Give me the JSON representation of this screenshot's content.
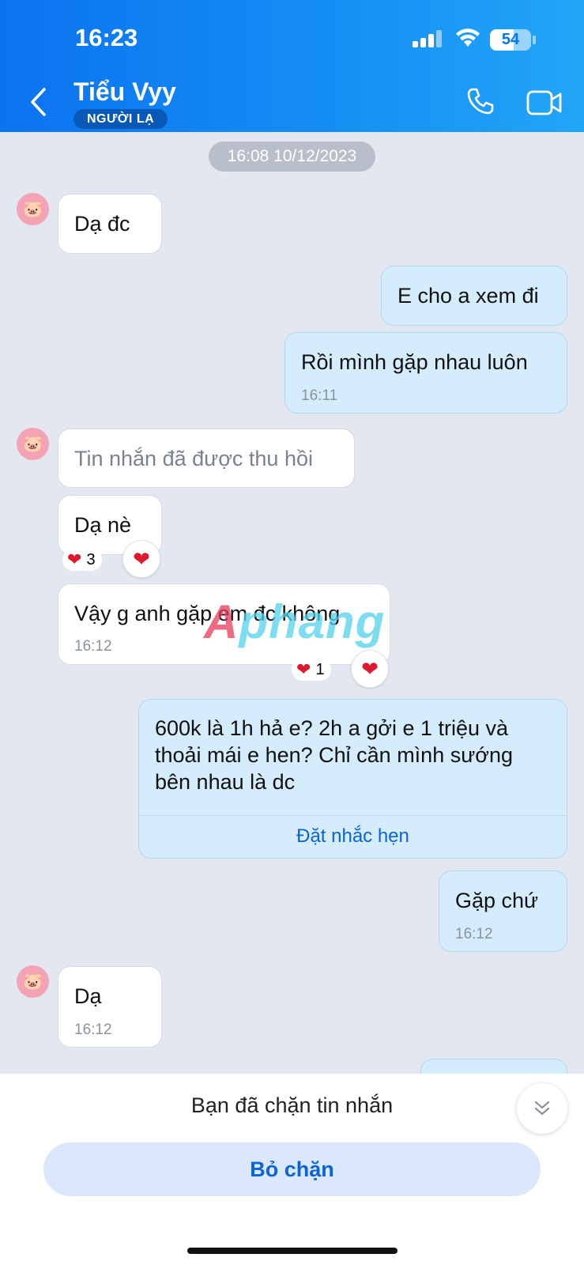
{
  "status_bar": {
    "time": "16:23",
    "battery": "54"
  },
  "header": {
    "contact_name": "Tiểu Vyy",
    "badge": "NGƯỜI LẠ"
  },
  "chat": {
    "date_separator": "16:08 10/12/2023",
    "messages": [
      {
        "text": "Dạ đc"
      },
      {
        "text": "E cho a xem đi"
      },
      {
        "text": "Rồi mình gặp nhau luôn",
        "time": "16:11"
      },
      {
        "text": "Tin nhắn đã được thu hồi"
      },
      {
        "text": "Dạ nè",
        "reaction_count": "3"
      },
      {
        "text": "Vậy g anh gặp em đc không",
        "time": "16:12",
        "reaction_count": "1"
      },
      {
        "text_lines": [
          "600k là 1h hả e? 2h a gởi e 1 triệu và",
          "thoải mái e hen? Chỉ cần mình sướng",
          "bên nhau là dc"
        ],
        "action": "Đặt nhắc hẹn"
      },
      {
        "text": "Gặp chứ",
        "time": "16:12"
      },
      {
        "text": "Dạ",
        "time": "16:12"
      }
    ]
  },
  "watermark": {
    "prefix": "A",
    "rest": "phang"
  },
  "footer": {
    "blocked_text": "Bạn đã chặn tin nhắn",
    "unblock_label": "Bỏ chặn"
  },
  "colors": {
    "header": "#0b73f0",
    "incoming_bubble": "#ffffff",
    "outgoing_bubble": "#d5ecfd",
    "accent": "#0b63d4",
    "heart": "#e0182d"
  }
}
